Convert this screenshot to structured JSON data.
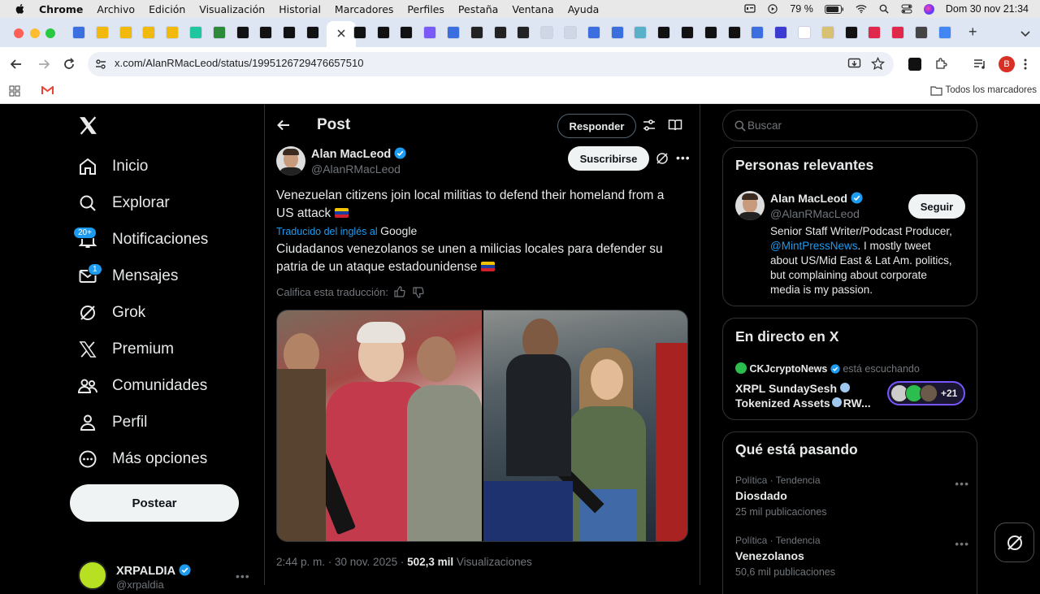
{
  "menubar": {
    "app": "Chrome",
    "items": [
      "Archivo",
      "Edición",
      "Visualización",
      "Historial",
      "Marcadores",
      "Perfiles",
      "Pestaña",
      "Ventana",
      "Ayuda"
    ],
    "battery": "79 %",
    "datetime": "Dom 30 nov 21:34"
  },
  "browser": {
    "url": "x.com/AlanRMacLeod/status/1995126729476657510",
    "bookmarks_label": "Todos los marcadores",
    "profile_initial": "B"
  },
  "sidebar": {
    "items": [
      {
        "label": "Inicio",
        "icon": "home-icon"
      },
      {
        "label": "Explorar",
        "icon": "search-icon"
      },
      {
        "label": "Notificaciones",
        "icon": "bell-icon",
        "badge": "20+"
      },
      {
        "label": "Mensajes",
        "icon": "mail-icon",
        "badge": "1"
      },
      {
        "label": "Grok",
        "icon": "grok-icon"
      },
      {
        "label": "Premium",
        "icon": "x-logo-icon"
      },
      {
        "label": "Comunidades",
        "icon": "communities-icon"
      },
      {
        "label": "Perfil",
        "icon": "profile-icon"
      },
      {
        "label": "Más opciones",
        "icon": "more-icon"
      }
    ],
    "post_button": "Postear",
    "account_name": "XRPALDIA",
    "account_handle": "@xrpaldia"
  },
  "post": {
    "header_title": "Post",
    "reply_button": "Responder",
    "author_name": "Alan MacLeod",
    "author_handle": "@AlanRMacLeod",
    "subscribe_button": "Suscribirse",
    "text_original": "Venezuelan citizens join local militias to defend their homeland from a US attack",
    "translated_by": "Traducido del inglés al",
    "translator": "Google",
    "text_translated": "Ciudadanos venezolanos se unen a milicias locales para defender su patria de un ataque estadounidense",
    "rate_translation": "Califica esta traducción:",
    "timestamp": "2:44 p. m. · 30 nov. 2025 ·",
    "views_count": "502,3 mil",
    "views_label": "Visualizaciones"
  },
  "right": {
    "search_placeholder": "Buscar",
    "relevant_title": "Personas relevantes",
    "relevant_name": "Alan MacLeod",
    "relevant_handle": "@AlanRMacLeod",
    "follow_button": "Seguir",
    "bio_1": "Senior Staff Writer/Podcast Producer,",
    "bio_link": "@MintPressNews",
    "bio_2": ". I mostly tweet",
    "bio_3": "about US/Mid East & Lat Am. politics,",
    "bio_4": "but complaining about corporate",
    "bio_5": "media is my passion.",
    "live_title": "En directo en X",
    "live_host": "CKJcryptoNews",
    "live_status": "está escuchando",
    "live_line1": "XRPL SundaySesh",
    "live_line2": "Tokenized Assets",
    "live_line2_tail": "RW...",
    "live_count": "+21",
    "trends_title": "Qué está pasando",
    "trends": [
      {
        "context": "Política · Tendencia",
        "name": "Diosdado",
        "count": "25 mil publicaciones"
      },
      {
        "context": "Política · Tendencia",
        "name": "Venezolanos",
        "count": "50,6 mil publicaciones"
      }
    ]
  },
  "colors": {
    "background": "#000000",
    "text": "#e7e9ea",
    "muted": "#71767b",
    "accent": "#1d9bf0",
    "border": "#2f3336"
  }
}
